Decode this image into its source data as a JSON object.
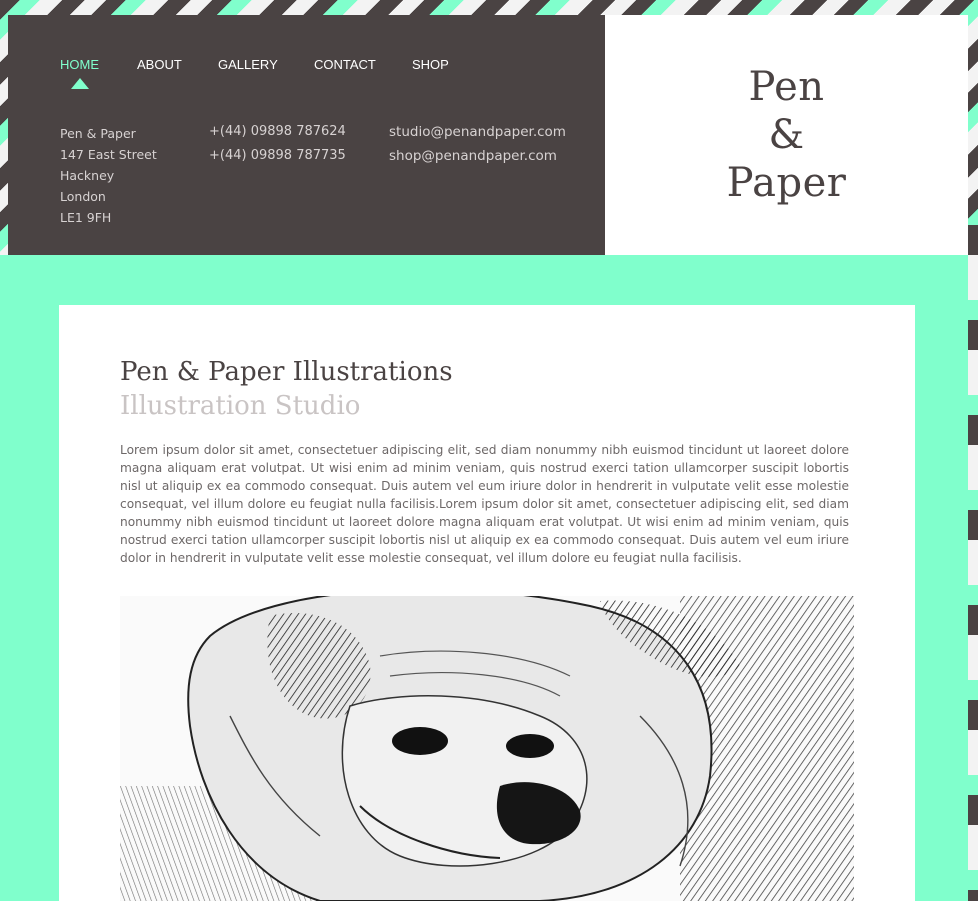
{
  "nav": {
    "items": [
      {
        "label": "HOME",
        "active": true
      },
      {
        "label": "ABOUT",
        "active": false
      },
      {
        "label": "GALLERY",
        "active": false
      },
      {
        "label": "CONTACT",
        "active": false
      },
      {
        "label": "SHOP",
        "active": false
      }
    ]
  },
  "address": {
    "lines": [
      "Pen & Paper",
      "147 East Street",
      "Hackney",
      "London",
      "LE1 9FH"
    ]
  },
  "phones": [
    "+(44) 09898 787624",
    "+(44) 09898 787735"
  ],
  "emails": [
    "studio@penandpaper.com",
    "shop@penandpaper.com"
  ],
  "logo": {
    "line1": "Pen",
    "line2": "&",
    "line3": "Paper"
  },
  "content": {
    "title": "Pen & Paper Illustrations",
    "subtitle": "Illustration Studio",
    "body": "Lorem ipsum dolor sit amet, consectetuer adipiscing elit, sed diam nonummy nibh euismod tincidunt ut laoreet dolore magna aliquam erat volutpat. Ut wisi enim ad minim veniam, quis nostrud exerci tation ullamcorper suscipit lobortis nisl ut aliquip ex ea commodo consequat. Duis autem vel eum iriure dolor in hendrerit in vulputate velit esse molestie consequat, vel illum dolore eu feugiat nulla facilisis.Lorem ipsum dolor sit amet, consectetuer adipiscing elit, sed diam nonummy nibh euismod tincidunt ut laoreet dolore magna aliquam erat volutpat. Ut wisi enim ad minim veniam, quis nostrud exerci tation ullamcorper suscipit lobortis nisl ut aliquip ex ea commodo consequat. Duis autem vel eum iriure dolor in hendrerit in vulputate velit esse molestie consequat, vel illum dolore eu feugiat nulla facilisis."
  },
  "colors": {
    "dark": "#4a4343",
    "accent": "#80ffcc",
    "white": "#ffffff"
  }
}
